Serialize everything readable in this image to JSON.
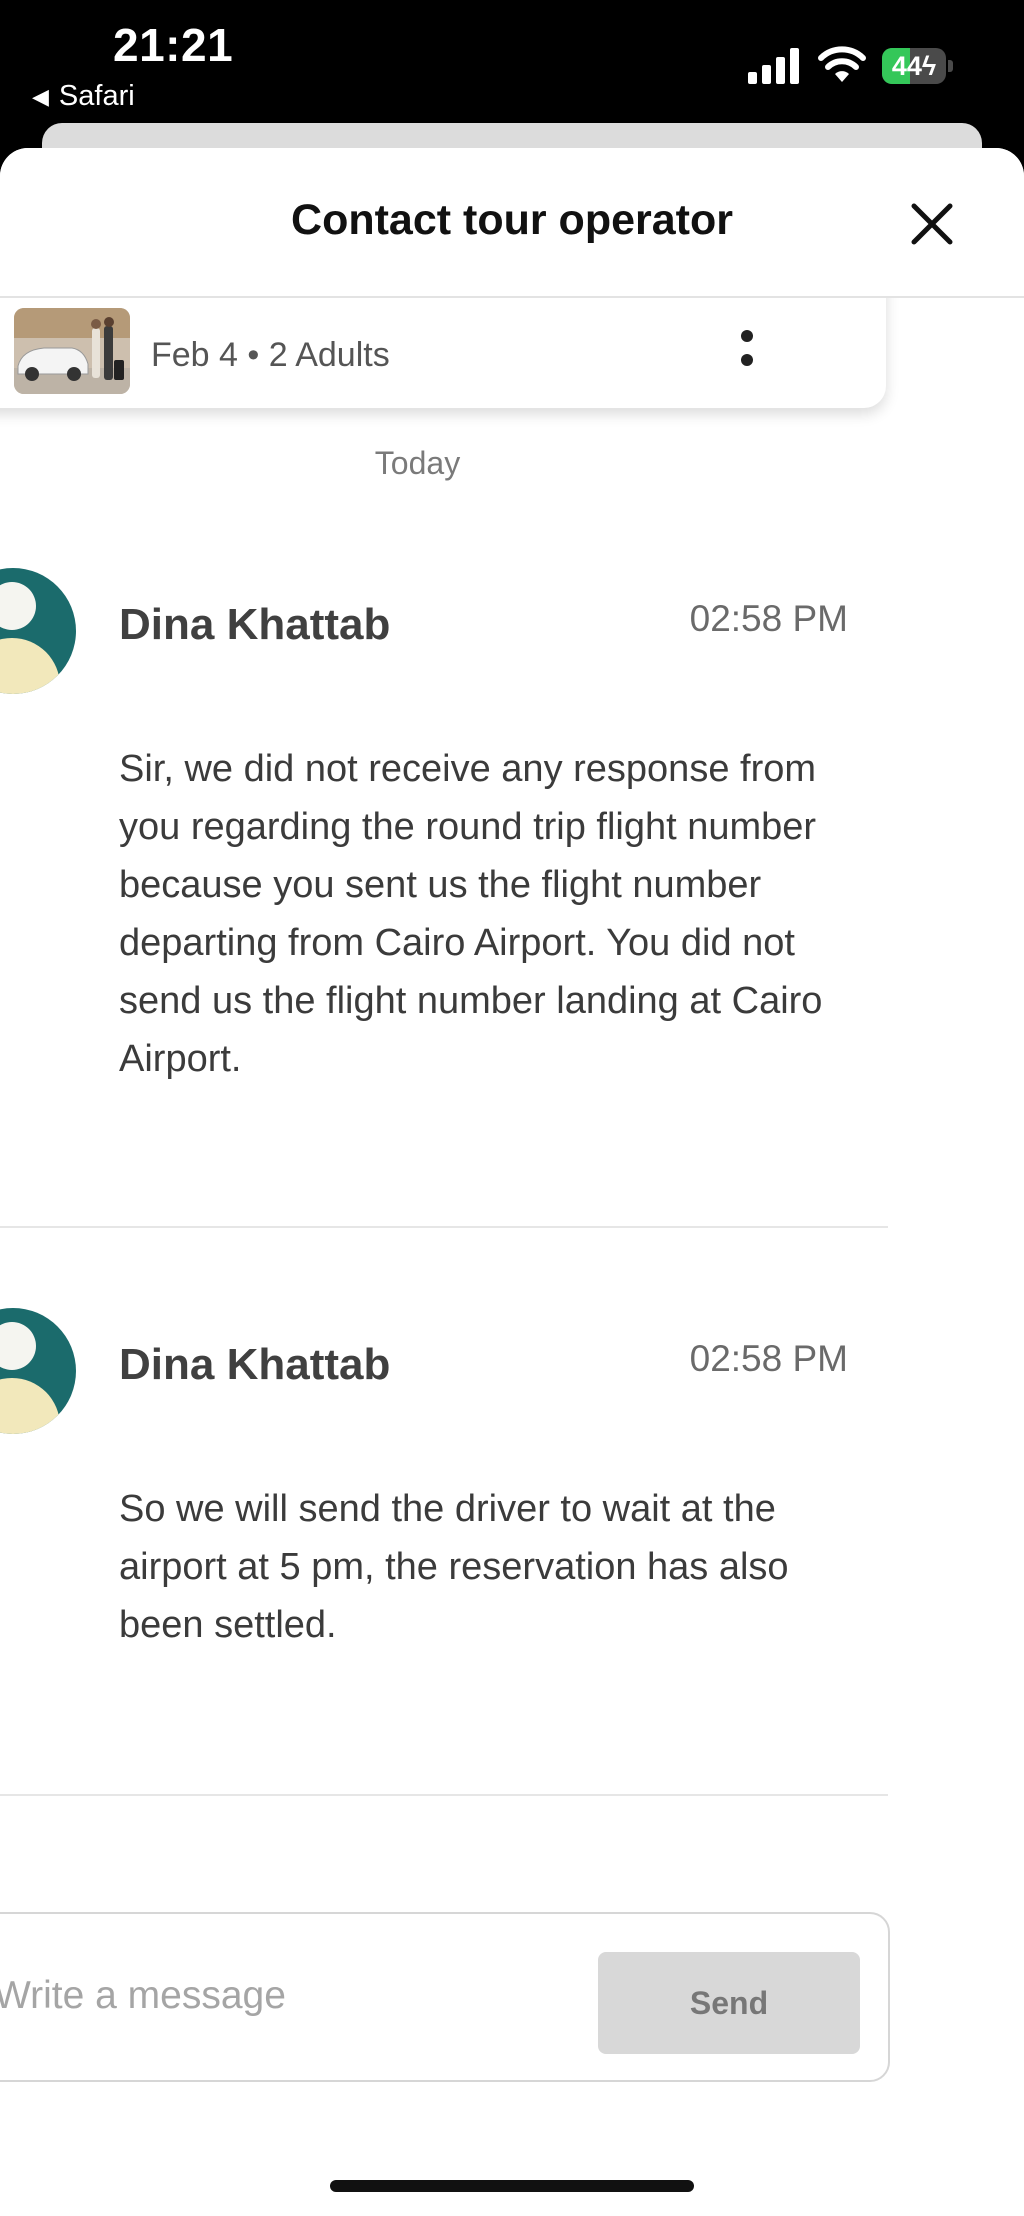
{
  "status_bar": {
    "time": "21:21",
    "back_app": "Safari",
    "battery_level": "44",
    "battery_percent": 44
  },
  "header": {
    "title": "Contact tour operator"
  },
  "booking": {
    "meta": "Feb 4 • 2 Adults"
  },
  "chat": {
    "day_label": "Today",
    "messages": [
      {
        "sender": "Dina Khattab",
        "time": "02:58 PM",
        "text": "Sir, we did not receive any response from you regarding the round trip flight number because you sent us the flight number departing from Cairo Airport. You did not send us the flight number landing at Cairo Airport."
      },
      {
        "sender": "Dina Khattab",
        "time": "02:58 PM",
        "text": "So we will send the driver to wait at the airport at 5 pm, the reservation has also been settled."
      }
    ]
  },
  "composer": {
    "placeholder": "Write a message",
    "value": "",
    "send_label": "Send"
  },
  "colors": {
    "avatar_bg": "#1b6b6c",
    "send_button_bg": "#d8d8d8",
    "battery_green": "#34c759"
  }
}
